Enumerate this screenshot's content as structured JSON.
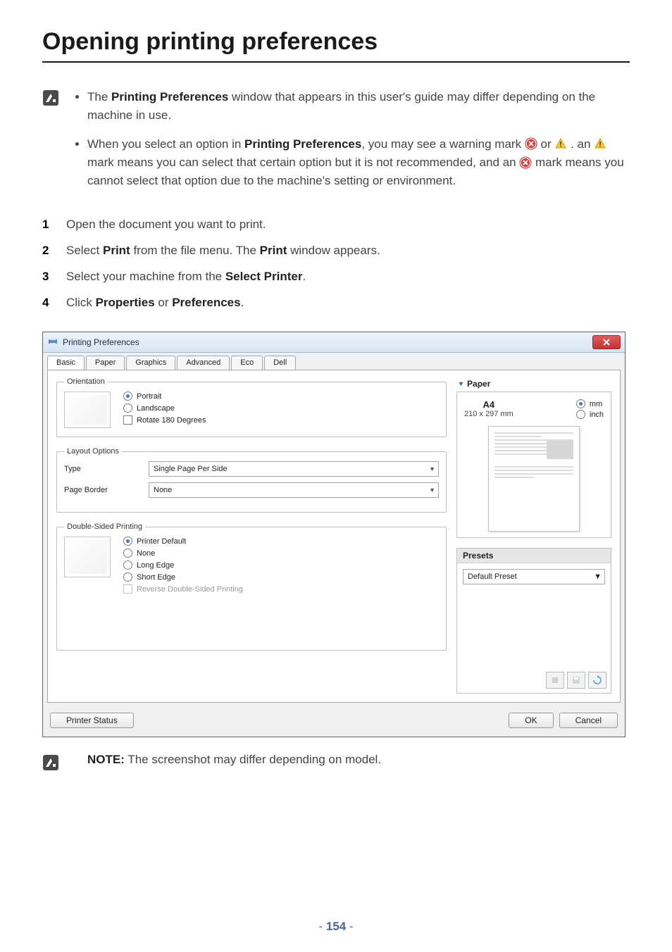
{
  "title": "Opening printing preferences",
  "intro": {
    "bullets": [
      {
        "pre": "The ",
        "bold1": "Printing Preferences",
        "post": " window that appears in this user's guide may differ depending on the machine in use."
      },
      {
        "pre": "When you select an option in ",
        "bold1": "Printing Preferences",
        "mid1": ", you may see a warning mark ",
        "mid2": " or ",
        "mid3": " . an ",
        "mid4": "  mark means you can select that certain option but it is not recommended, and an ",
        "mid5": "  mark means you cannot select that option due to the machine's setting or environment."
      }
    ]
  },
  "steps": [
    {
      "t1": "Open the document you want to print."
    },
    {
      "t1": "Select ",
      "b1": "Print",
      "t2": " from the file menu. The ",
      "b2": "Print",
      "t3": " window appears."
    },
    {
      "t1": "Select your machine from the ",
      "b1": "Select Printer",
      "t2": "."
    },
    {
      "t1": "Click ",
      "b1": "Properties",
      "t2": " or ",
      "b2": "Preferences",
      "t3": "."
    }
  ],
  "dialog": {
    "title": "Printing Preferences",
    "tabs": [
      "Basic",
      "Paper",
      "Graphics",
      "Advanced",
      "Eco",
      "Dell"
    ],
    "activeTab": "Basic",
    "orientation": {
      "legend": "Orientation",
      "portrait": "Portrait",
      "landscape": "Landscape",
      "rotate": "Rotate 180 Degrees"
    },
    "layout": {
      "legend": "Layout Options",
      "typeLabel": "Type",
      "typeValue": "Single Page Per Side",
      "borderLabel": "Page Border",
      "borderValue": "None"
    },
    "dsp": {
      "legend": "Double-Sided Printing",
      "printerDefault": "Printer Default",
      "none": "None",
      "longEdge": "Long Edge",
      "shortEdge": "Short Edge",
      "reverse": "Reverse Double-Sided Printing"
    },
    "paperPanel": {
      "header": "Paper",
      "size": "A4",
      "dim": "210 x 297 mm",
      "unit_mm": "mm",
      "unit_in": "inch"
    },
    "presets": {
      "header": "Presets",
      "value": "Default Preset"
    },
    "footer": {
      "printerStatus": "Printer Status",
      "ok": "OK",
      "cancel": "Cancel"
    }
  },
  "note": {
    "label": "NOTE:",
    "text": " The screenshot may differ depending on model."
  },
  "pageNumber": "154"
}
